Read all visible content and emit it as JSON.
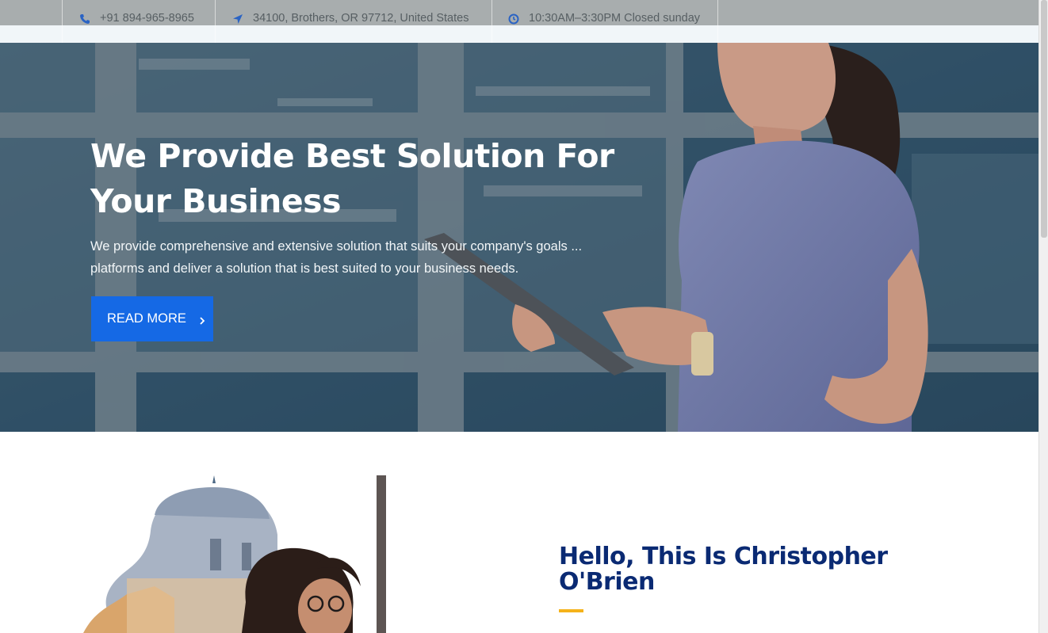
{
  "topbar": {
    "phone": {
      "icon": "phone-icon",
      "text": "+91 894-965-8965"
    },
    "address": {
      "icon": "navigation-arrow-icon",
      "text": "34100, Brothers, OR 97712, United States"
    },
    "hours": {
      "icon": "clock-icon",
      "text": "10:30AM–3:30PM Closed sunday"
    }
  },
  "hero": {
    "title": "We Provide Best Solution For Your Business",
    "text": "We provide comprehensive and extensive solution that suits your company's goals ... platforms and deliver a solution that is best suited to your business needs.",
    "button_label": "READ MORE",
    "button_icon": "chevron-right-icon"
  },
  "about": {
    "title": "Hello, This Is Christopher O'Brien"
  },
  "colors": {
    "accent_blue": "#1569e5",
    "heading_navy": "#0a2a73",
    "underline_yellow": "#f5b21a",
    "icon_blue": "#2a63c4"
  }
}
